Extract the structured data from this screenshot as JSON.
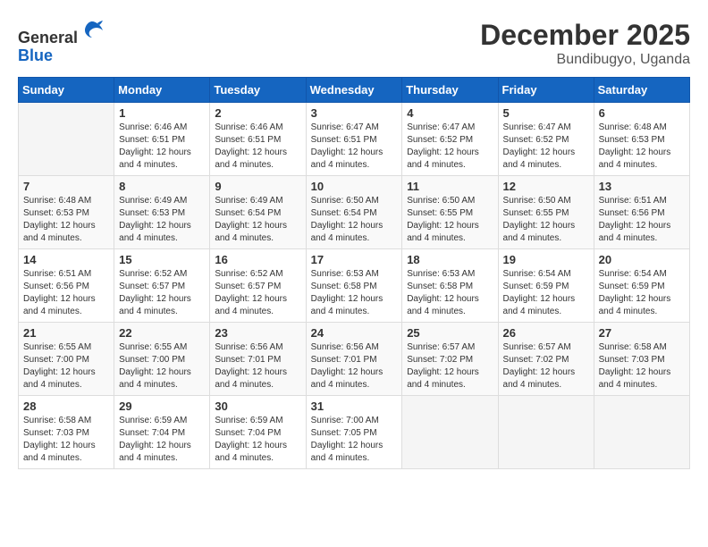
{
  "logo": {
    "text_general": "General",
    "text_blue": "Blue"
  },
  "title": {
    "month": "December 2025",
    "location": "Bundibugyo, Uganda"
  },
  "headers": [
    "Sunday",
    "Monday",
    "Tuesday",
    "Wednesday",
    "Thursday",
    "Friday",
    "Saturday"
  ],
  "weeks": [
    [
      {
        "day": "",
        "info": ""
      },
      {
        "day": "1",
        "info": "Sunrise: 6:46 AM\nSunset: 6:51 PM\nDaylight: 12 hours\nand 4 minutes."
      },
      {
        "day": "2",
        "info": "Sunrise: 6:46 AM\nSunset: 6:51 PM\nDaylight: 12 hours\nand 4 minutes."
      },
      {
        "day": "3",
        "info": "Sunrise: 6:47 AM\nSunset: 6:51 PM\nDaylight: 12 hours\nand 4 minutes."
      },
      {
        "day": "4",
        "info": "Sunrise: 6:47 AM\nSunset: 6:52 PM\nDaylight: 12 hours\nand 4 minutes."
      },
      {
        "day": "5",
        "info": "Sunrise: 6:47 AM\nSunset: 6:52 PM\nDaylight: 12 hours\nand 4 minutes."
      },
      {
        "day": "6",
        "info": "Sunrise: 6:48 AM\nSunset: 6:53 PM\nDaylight: 12 hours\nand 4 minutes."
      }
    ],
    [
      {
        "day": "7",
        "info": "Sunrise: 6:48 AM\nSunset: 6:53 PM\nDaylight: 12 hours\nand 4 minutes."
      },
      {
        "day": "8",
        "info": "Sunrise: 6:49 AM\nSunset: 6:53 PM\nDaylight: 12 hours\nand 4 minutes."
      },
      {
        "day": "9",
        "info": "Sunrise: 6:49 AM\nSunset: 6:54 PM\nDaylight: 12 hours\nand 4 minutes."
      },
      {
        "day": "10",
        "info": "Sunrise: 6:50 AM\nSunset: 6:54 PM\nDaylight: 12 hours\nand 4 minutes."
      },
      {
        "day": "11",
        "info": "Sunrise: 6:50 AM\nSunset: 6:55 PM\nDaylight: 12 hours\nand 4 minutes."
      },
      {
        "day": "12",
        "info": "Sunrise: 6:50 AM\nSunset: 6:55 PM\nDaylight: 12 hours\nand 4 minutes."
      },
      {
        "day": "13",
        "info": "Sunrise: 6:51 AM\nSunset: 6:56 PM\nDaylight: 12 hours\nand 4 minutes."
      }
    ],
    [
      {
        "day": "14",
        "info": "Sunrise: 6:51 AM\nSunset: 6:56 PM\nDaylight: 12 hours\nand 4 minutes."
      },
      {
        "day": "15",
        "info": "Sunrise: 6:52 AM\nSunset: 6:57 PM\nDaylight: 12 hours\nand 4 minutes."
      },
      {
        "day": "16",
        "info": "Sunrise: 6:52 AM\nSunset: 6:57 PM\nDaylight: 12 hours\nand 4 minutes."
      },
      {
        "day": "17",
        "info": "Sunrise: 6:53 AM\nSunset: 6:58 PM\nDaylight: 12 hours\nand 4 minutes."
      },
      {
        "day": "18",
        "info": "Sunrise: 6:53 AM\nSunset: 6:58 PM\nDaylight: 12 hours\nand 4 minutes."
      },
      {
        "day": "19",
        "info": "Sunrise: 6:54 AM\nSunset: 6:59 PM\nDaylight: 12 hours\nand 4 minutes."
      },
      {
        "day": "20",
        "info": "Sunrise: 6:54 AM\nSunset: 6:59 PM\nDaylight: 12 hours\nand 4 minutes."
      }
    ],
    [
      {
        "day": "21",
        "info": "Sunrise: 6:55 AM\nSunset: 7:00 PM\nDaylight: 12 hours\nand 4 minutes."
      },
      {
        "day": "22",
        "info": "Sunrise: 6:55 AM\nSunset: 7:00 PM\nDaylight: 12 hours\nand 4 minutes."
      },
      {
        "day": "23",
        "info": "Sunrise: 6:56 AM\nSunset: 7:01 PM\nDaylight: 12 hours\nand 4 minutes."
      },
      {
        "day": "24",
        "info": "Sunrise: 6:56 AM\nSunset: 7:01 PM\nDaylight: 12 hours\nand 4 minutes."
      },
      {
        "day": "25",
        "info": "Sunrise: 6:57 AM\nSunset: 7:02 PM\nDaylight: 12 hours\nand 4 minutes."
      },
      {
        "day": "26",
        "info": "Sunrise: 6:57 AM\nSunset: 7:02 PM\nDaylight: 12 hours\nand 4 minutes."
      },
      {
        "day": "27",
        "info": "Sunrise: 6:58 AM\nSunset: 7:03 PM\nDaylight: 12 hours\nand 4 minutes."
      }
    ],
    [
      {
        "day": "28",
        "info": "Sunrise: 6:58 AM\nSunset: 7:03 PM\nDaylight: 12 hours\nand 4 minutes."
      },
      {
        "day": "29",
        "info": "Sunrise: 6:59 AM\nSunset: 7:04 PM\nDaylight: 12 hours\nand 4 minutes."
      },
      {
        "day": "30",
        "info": "Sunrise: 6:59 AM\nSunset: 7:04 PM\nDaylight: 12 hours\nand 4 minutes."
      },
      {
        "day": "31",
        "info": "Sunrise: 7:00 AM\nSunset: 7:05 PM\nDaylight: 12 hours\nand 4 minutes."
      },
      {
        "day": "",
        "info": ""
      },
      {
        "day": "",
        "info": ""
      },
      {
        "day": "",
        "info": ""
      }
    ]
  ]
}
